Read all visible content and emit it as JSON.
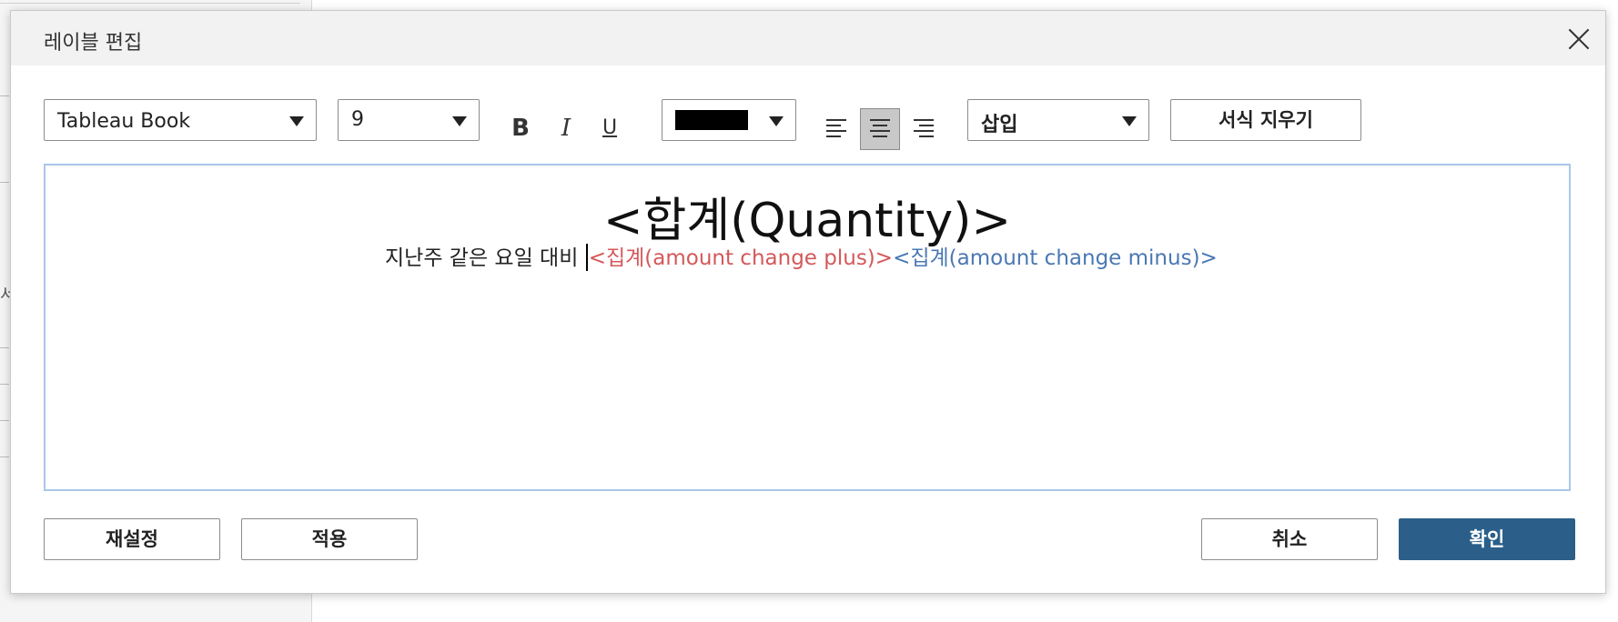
{
  "background": {
    "left_fragments": [
      "서"
    ]
  },
  "dialog": {
    "title": "레이블 편집",
    "close_icon": "close-icon"
  },
  "toolbar": {
    "font_family": "Tableau Book",
    "font_size": "9",
    "bold_label": "B",
    "italic_label": "I",
    "underline_label": "U",
    "text_color": "#000000",
    "align_selected": "center",
    "insert_label": "삽입",
    "clear_format_label": "서식 지우기"
  },
  "editor": {
    "line1": "<합계(Quantity)>",
    "line2_plain": "지난주 같은 요일 대비 ",
    "line2_red": "<집계(amount change plus)>",
    "line2_blue": "<집계(amount change minus)>",
    "colors": {
      "red": "#d4585a",
      "blue": "#4a78b4"
    }
  },
  "buttons": {
    "reset": "재설정",
    "apply": "적용",
    "cancel": "취소",
    "ok": "확인"
  },
  "colors": {
    "primary": "#2b5f89",
    "editor_border": "#a9c7ea"
  }
}
